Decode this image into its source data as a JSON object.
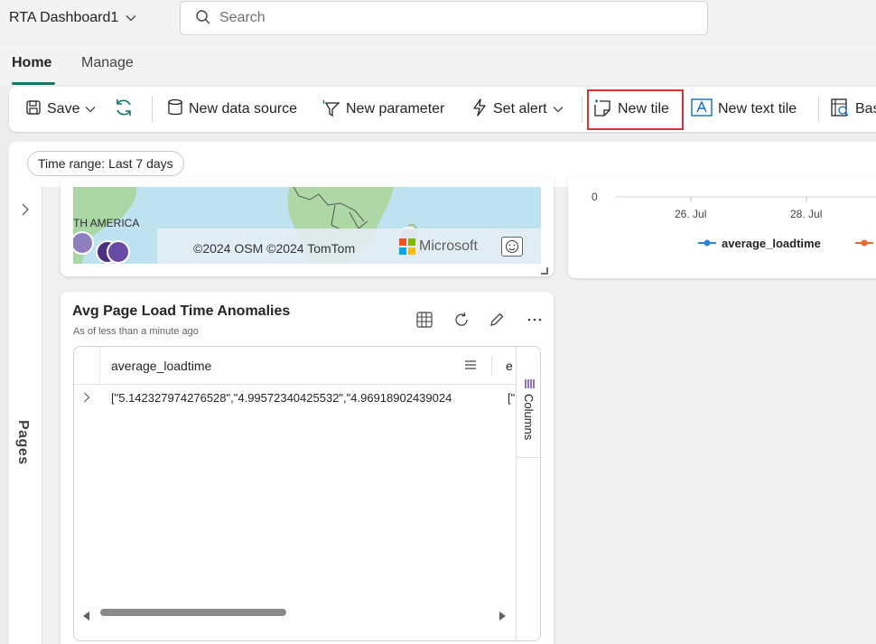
{
  "app": {
    "title": "RTA Dashboard1",
    "search_placeholder": "Search"
  },
  "tabs": [
    {
      "label": "Home",
      "active": true
    },
    {
      "label": "Manage",
      "active": false
    }
  ],
  "toolbar": {
    "save_label": "Save",
    "new_data_source_label": "New data source",
    "new_parameter_label": "New parameter",
    "set_alert_label": "Set alert",
    "new_tile_label": "New tile",
    "new_text_tile_label": "New text tile",
    "base_query_label": "Bas"
  },
  "filters": {
    "time_range_label": "Time range: Last 7 days"
  },
  "sidebar": {
    "pages_label": "Pages"
  },
  "map_tile": {
    "region_label": "TH AMERICA",
    "attribution": "©2024 OSM  ©2024 TomTom",
    "brand": "Microsoft"
  },
  "chart_data": {
    "type": "line",
    "x_ticks": [
      "26. Jul",
      "28. Jul"
    ],
    "y_ticks": [
      "0"
    ],
    "series": [
      {
        "name": "average_loadtime",
        "color": "#2b88d8"
      },
      {
        "name": "",
        "color": "#e8692a"
      }
    ],
    "legend_position": "bottom"
  },
  "anomaly_tile": {
    "title": "Avg Page Load Time Anomalies",
    "subtitle": "As of less than a minute ago",
    "columns": [
      "average_loadtime",
      "e"
    ],
    "rows": [
      {
        "average_loadtime": "[\"5.142327974276528\",\"4.99572340425532\",\"4.96918902439024",
        "e": "[\""
      }
    ],
    "columns_panel_label": "Columns"
  },
  "colors": {
    "accent": "#117865",
    "highlight": "#d13438"
  },
  "icons": [
    "chevron-down-icon",
    "search-icon",
    "save-icon",
    "refresh-icon",
    "database-icon",
    "parameter-icon",
    "alert-icon",
    "new-tile-icon",
    "text-tile-icon",
    "base-query-icon",
    "chevron-right-icon",
    "table-icon",
    "pencil-icon",
    "more-icon",
    "menu-icon",
    "columns-icon"
  ]
}
